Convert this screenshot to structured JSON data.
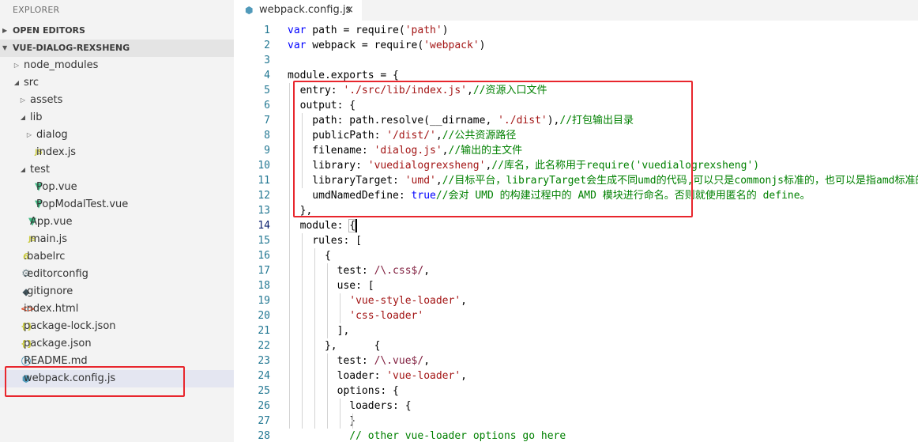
{
  "explorer": {
    "title": "EXPLORER",
    "open_editors_label": "OPEN EDITORS",
    "project_label": "VUE-DIALOG-REXSHENG",
    "tree": [
      {
        "label": "node_modules",
        "depth": 0,
        "type": "folder",
        "state": "closed",
        "icon": "chevron-right-icon"
      },
      {
        "label": "src",
        "depth": 0,
        "type": "folder",
        "state": "open",
        "icon": "chevron-down-icon"
      },
      {
        "label": "assets",
        "depth": 1,
        "type": "folder",
        "state": "closed",
        "icon": "chevron-right-icon"
      },
      {
        "label": "lib",
        "depth": 1,
        "type": "folder",
        "state": "open",
        "icon": "chevron-down-icon"
      },
      {
        "label": "dialog",
        "depth": 2,
        "type": "folder",
        "state": "closed",
        "icon": "chevron-right-icon"
      },
      {
        "label": "index.js",
        "depth": 2,
        "type": "file",
        "icon": "js-file-icon"
      },
      {
        "label": "test",
        "depth": 1,
        "type": "folder",
        "state": "open",
        "icon": "chevron-down-icon"
      },
      {
        "label": "Pop.vue",
        "depth": 2,
        "type": "file",
        "icon": "vue-file-icon"
      },
      {
        "label": "PopModalTest.vue",
        "depth": 2,
        "type": "file",
        "icon": "vue-file-icon"
      },
      {
        "label": "App.vue",
        "depth": 1,
        "type": "file",
        "icon": "vue-file-icon"
      },
      {
        "label": "main.js",
        "depth": 1,
        "type": "file",
        "icon": "js-file-icon"
      },
      {
        "label": ".babelrc",
        "depth": 0,
        "type": "file",
        "icon": "babel-file-icon"
      },
      {
        "label": ".editorconfig",
        "depth": 0,
        "type": "file",
        "icon": "gear-icon"
      },
      {
        "label": ".gitignore",
        "depth": 0,
        "type": "file",
        "icon": "git-icon"
      },
      {
        "label": "index.html",
        "depth": 0,
        "type": "file",
        "icon": "html-file-icon"
      },
      {
        "label": "package-lock.json",
        "depth": 0,
        "type": "file",
        "icon": "json-file-icon"
      },
      {
        "label": "package.json",
        "depth": 0,
        "type": "file",
        "icon": "json-file-icon"
      },
      {
        "label": "README.md",
        "depth": 0,
        "type": "file",
        "icon": "info-icon"
      },
      {
        "label": "webpack.config.js",
        "depth": 0,
        "type": "file",
        "icon": "webpack-file-icon",
        "selected": true
      }
    ]
  },
  "tab": {
    "label": "webpack.config.js",
    "icon": "webpack-file-icon",
    "close_glyph": "×"
  },
  "editor": {
    "current_line": 14,
    "lines": [
      [
        [
          "var",
          "kw"
        ],
        [
          " path = require(",
          "pl"
        ],
        [
          "'path'",
          "str"
        ],
        [
          ")",
          "pl"
        ]
      ],
      [
        [
          "var",
          "kw"
        ],
        [
          " webpack = require(",
          "pl"
        ],
        [
          "'webpack'",
          "str"
        ],
        [
          ")",
          "pl"
        ]
      ],
      [],
      [
        [
          "module.exports = {",
          "pl"
        ]
      ],
      [
        [
          "  entry: ",
          "pl"
        ],
        [
          "'./src/lib/index.js'",
          "str"
        ],
        [
          ",",
          "pl"
        ],
        [
          "//资源入口文件",
          "cm"
        ]
      ],
      [
        [
          "  output: {",
          "pl"
        ]
      ],
      [
        [
          "    path: path.resolve(__dirname, ",
          "pl"
        ],
        [
          "'./dist'",
          "str"
        ],
        [
          "),",
          "pl"
        ],
        [
          "//打包输出目录",
          "cm"
        ]
      ],
      [
        [
          "    publicPath: ",
          "pl"
        ],
        [
          "'/dist/'",
          "str"
        ],
        [
          ",",
          "pl"
        ],
        [
          "//公共资源路径",
          "cm"
        ]
      ],
      [
        [
          "    filename: ",
          "pl"
        ],
        [
          "'dialog.js'",
          "str"
        ],
        [
          ",",
          "pl"
        ],
        [
          "//输出的主文件",
          "cm"
        ]
      ],
      [
        [
          "    library: ",
          "pl"
        ],
        [
          "'vuedialogrexsheng'",
          "str"
        ],
        [
          ",",
          "pl"
        ],
        [
          "//库名，此名称用于require('vuedialogrexsheng')",
          "cm"
        ]
      ],
      [
        [
          "    libraryTarget: ",
          "pl"
        ],
        [
          "'umd'",
          "str"
        ],
        [
          ",",
          "pl"
        ],
        [
          "//目标平台，libraryTarget会生成不同umd的代码,可以只是commonjs标准的，也可以是指amd标准的，也可以只是",
          "cm"
        ]
      ],
      [
        [
          "    umdNamedDefine: ",
          "pl"
        ],
        [
          "true",
          "kw"
        ],
        [
          "//会对 UMD 的构建过程中的 AMD 模块进行命名。否则就使用匿名的 define。",
          "cm"
        ]
      ],
      [
        [
          "  },",
          "pl"
        ]
      ],
      [
        [
          "  module: {",
          "pl"
        ]
      ],
      [
        [
          "    rules: [",
          "pl"
        ]
      ],
      [
        [
          "      {",
          "pl"
        ]
      ],
      [
        [
          "        test: ",
          "pl"
        ],
        [
          "/\\.css$/",
          "re"
        ],
        [
          ",",
          "pl"
        ]
      ],
      [
        [
          "        use: [",
          "pl"
        ]
      ],
      [
        [
          "          ",
          "pl"
        ],
        [
          "'vue-style-loader'",
          "str"
        ],
        [
          ",",
          "pl"
        ]
      ],
      [
        [
          "          ",
          "pl"
        ],
        [
          "'css-loader'",
          "str"
        ]
      ],
      [
        [
          "        ],",
          "pl"
        ]
      ],
      [
        [
          "      },      {",
          "pl"
        ]
      ],
      [
        [
          "        test: ",
          "pl"
        ],
        [
          "/\\.vue$/",
          "re"
        ],
        [
          ",",
          "pl"
        ]
      ],
      [
        [
          "        loader: ",
          "pl"
        ],
        [
          "'vue-loader'",
          "str"
        ],
        [
          ",",
          "pl"
        ]
      ],
      [
        [
          "        options: {",
          "pl"
        ]
      ],
      [
        [
          "          loaders: {",
          "pl"
        ]
      ],
      [
        [
          "          }",
          "pl"
        ]
      ],
      [
        [
          "          ",
          "pl"
        ],
        [
          "// other vue-loader options go here",
          "cm"
        ]
      ]
    ]
  },
  "colors": {
    "highlight_box": "#e8262d",
    "keyword": "#0000ff",
    "string": "#a31515",
    "comment": "#008000",
    "line_number": "#237893"
  }
}
